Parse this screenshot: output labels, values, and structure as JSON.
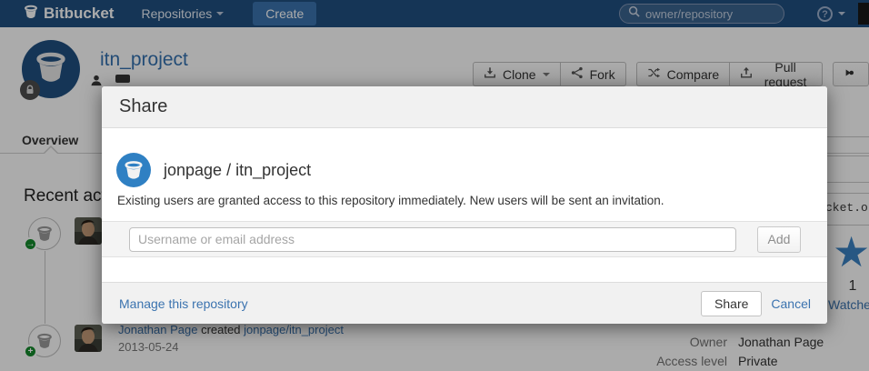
{
  "navbar": {
    "logo": "Bitbucket",
    "items": [
      {
        "label": "Repositories"
      }
    ],
    "create_label": "Create",
    "search_placeholder": "owner/repository",
    "help_glyph": "?"
  },
  "repo": {
    "title": "itn_project",
    "actions": {
      "clone": "Clone",
      "fork": "Fork",
      "compare": "Compare",
      "pull_request": "Pull request"
    }
  },
  "tabs": {
    "overview": "Overview"
  },
  "content": {
    "recent_heading": "Recent activity",
    "feed_event": {
      "user": "Jonathan Page",
      "verb": "created",
      "target": "jonpage/itn_project",
      "date": "2013-05-24"
    },
    "badge_push_glyph": "→",
    "badge_create_glyph": "+"
  },
  "sidebar": {
    "clone_url_fragment": "cket.org",
    "star_glyph": "★",
    "watch_count": "1",
    "watch_label": "Watchers",
    "owner_label": "Owner",
    "owner_value": "Jonathan Page",
    "access_label": "Access level",
    "access_value": "Private"
  },
  "modal": {
    "title": "Share",
    "repo_full_name": "jonpage / itn_project",
    "description": "Existing users are granted access to this repository immediately. New users will be sent an invitation.",
    "input_placeholder": "Username or email address",
    "add_label": "Add",
    "manage_label": "Manage this repository",
    "share_label": "Share",
    "cancel_label": "Cancel"
  },
  "colors": {
    "navbar_bg": "#205081",
    "link_blue": "#3b73af",
    "create_button_bg": "#3b73af",
    "badge_green": "#14892c",
    "star_blue": "#3b82c4",
    "modal_chrome_gray": "#f1f1f1"
  }
}
